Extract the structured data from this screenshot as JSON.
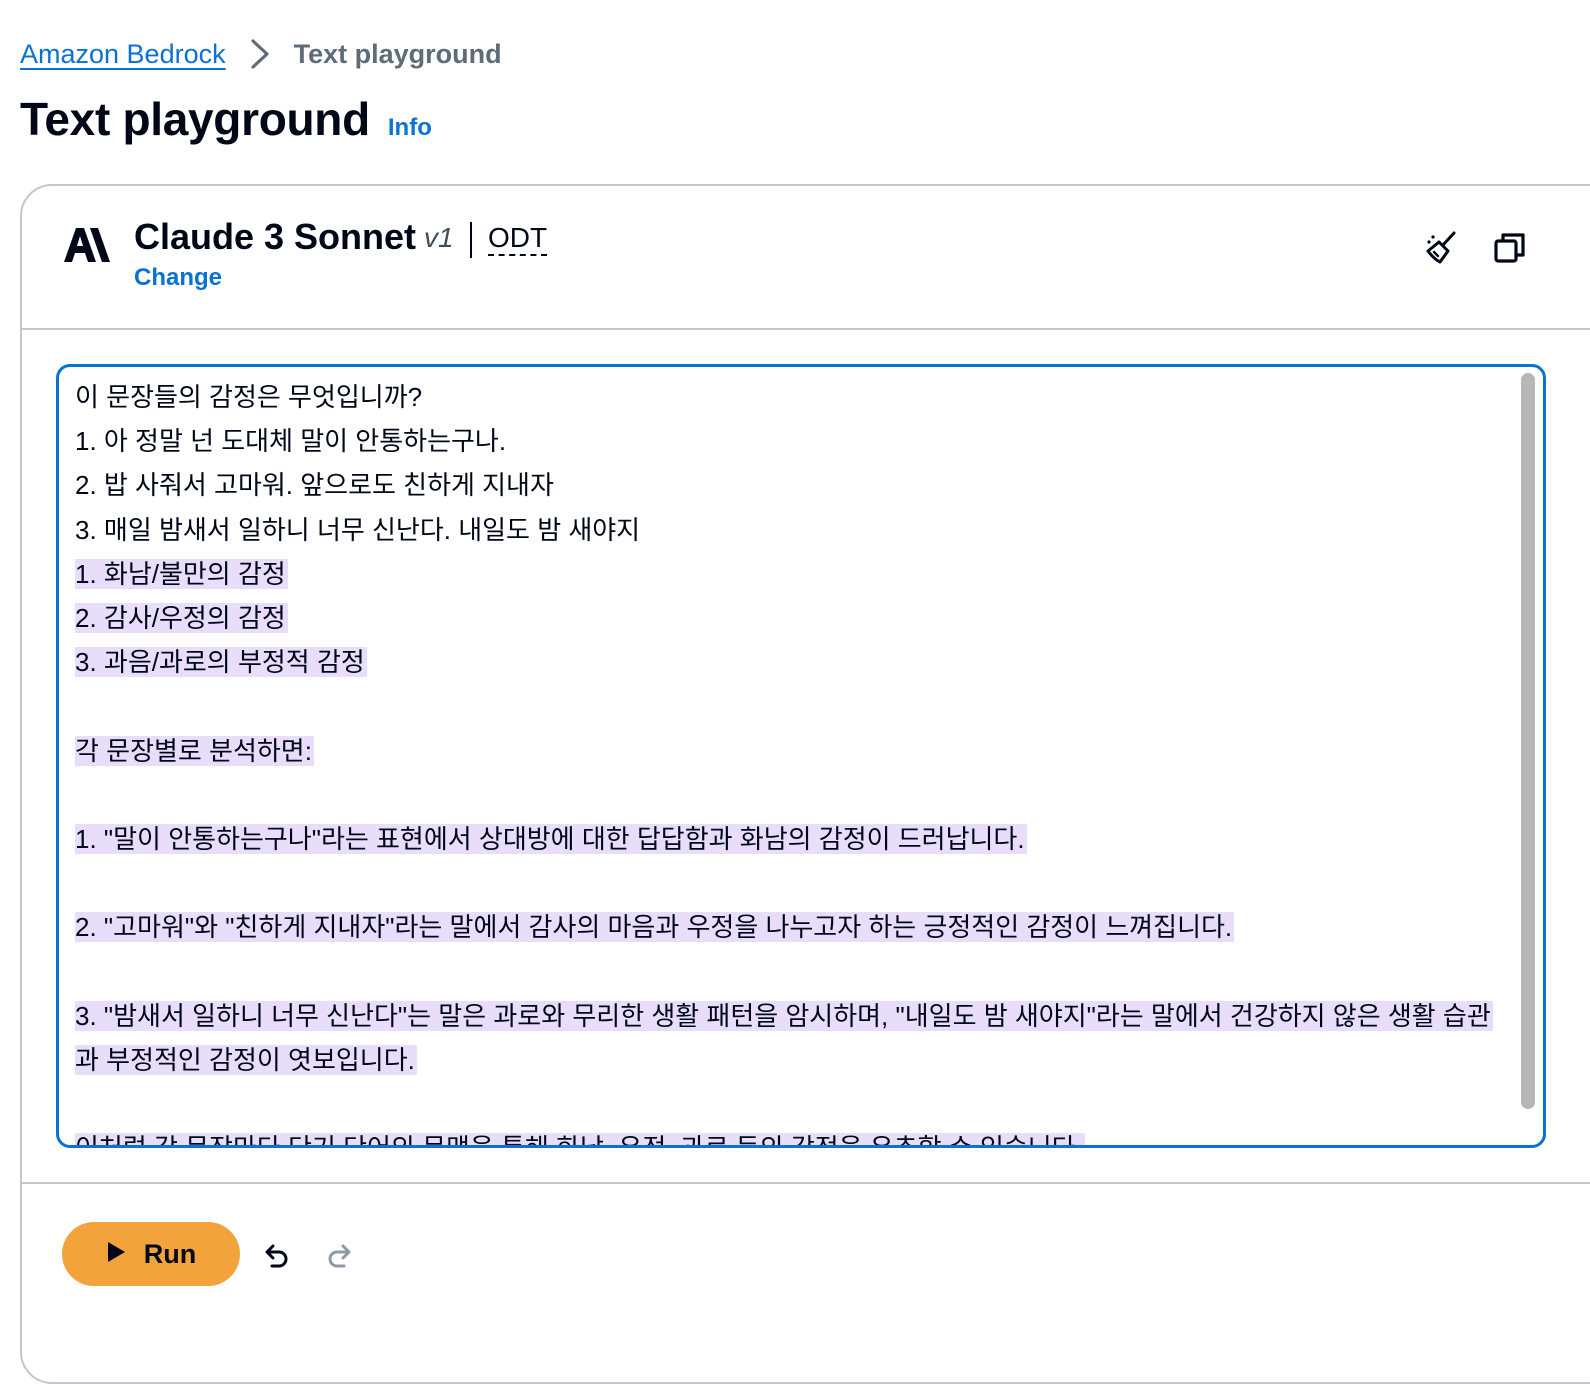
{
  "breadcrumb": {
    "parent": "Amazon Bedrock",
    "current": "Text playground"
  },
  "page": {
    "title": "Text playground",
    "info": "Info"
  },
  "model": {
    "name": "Claude 3 Sonnet",
    "version": "v1",
    "throughput": "ODT",
    "change_label": "Change",
    "logo_icon": "anthropic-logo-icon"
  },
  "toolbar": {
    "clear_icon": "broom-icon",
    "copy_icon": "copy-icon"
  },
  "editor": {
    "prompt_lines": [
      "이 문장들의 감정은 무엇입니까?",
      "1. 아 정말 넌 도대체 말이 안통하는구나.",
      "2. 밥 사줘서 고마워. 앞으로도 친하게 지내자",
      "3. 매일 밤새서 일하니 너무 신난다. 내일도 밤 새야지"
    ],
    "response_lines": [
      "1. 화남/불만의 감정",
      "2. 감사/우정의 감정",
      "3. 과음/과로의 부정적 감정",
      "",
      "각 문장별로 분석하면:",
      "",
      "1. \"말이 안통하는구나\"라는 표현에서 상대방에 대한 답답함과 화남의 감정이 드러납니다.",
      "",
      "2. \"고마워\"와 \"친하게 지내자\"라는 말에서 감사의 마음과 우정을 나누고자 하는 긍정적인 감정이 느껴집니다.",
      "",
      "3. \"밤새서 일하니 너무 신난다\"는 말은 과로와 무리한 생활 패턴을 암시하며, \"내일도 밤 새야지\"라는 말에서 건강하지 않은 생활 습관",
      "과 부정적인 감정이 엿보입니다.",
      "",
      "이처럼 각 문장마다 단기 단어의 문맥을 통해 화남, 우정, 과로 등의 감정을 유추할 수 있습니다."
    ],
    "highlight_color": "#e9ddfc",
    "border_color": "#0972d3"
  },
  "actions": {
    "run_label": "Run",
    "run_color": "#f3a33b",
    "undo_icon": "undo-icon",
    "redo_icon": "redo-icon"
  }
}
